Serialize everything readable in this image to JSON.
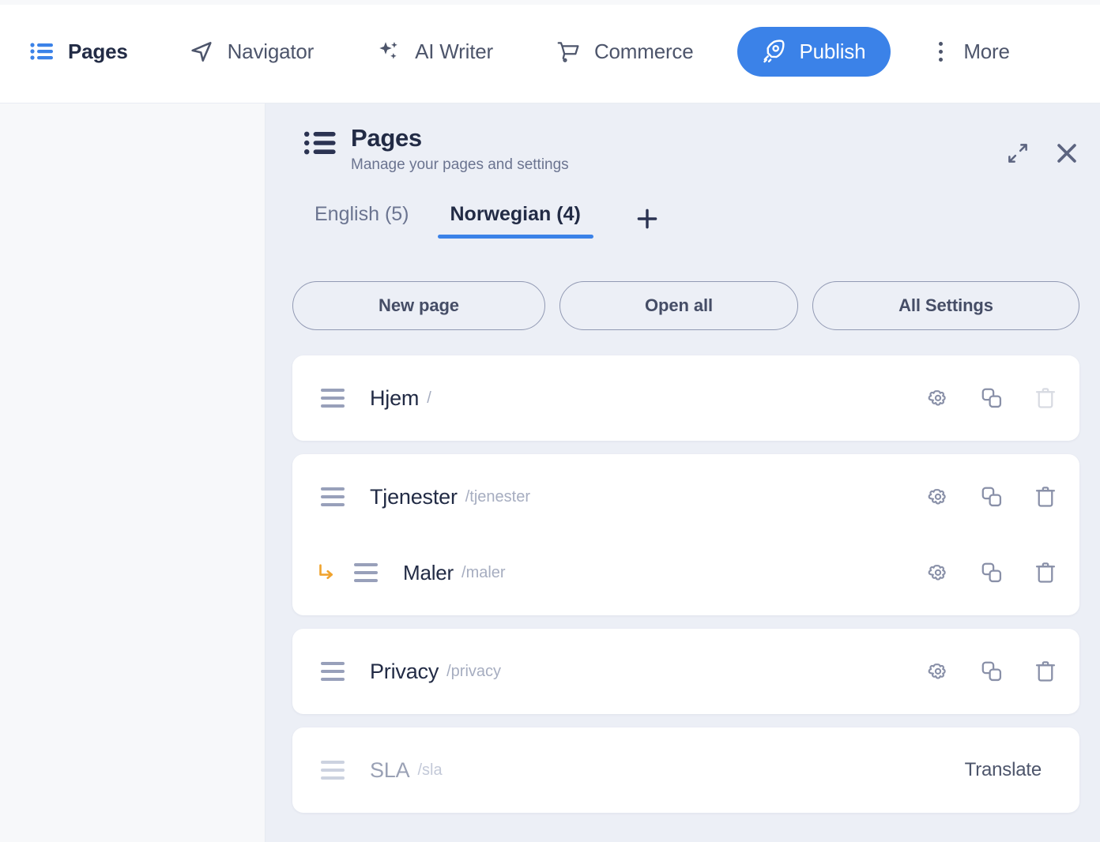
{
  "topbar": {
    "items": [
      {
        "id": "pages",
        "label": "Pages",
        "icon": "list-icon",
        "active": true
      },
      {
        "id": "navigator",
        "label": "Navigator",
        "icon": "navigate-icon",
        "active": false
      },
      {
        "id": "aiwriter",
        "label": "AI Writer",
        "icon": "sparkles-icon",
        "active": false
      },
      {
        "id": "commerce",
        "label": "Commerce",
        "icon": "cart-icon",
        "active": false
      }
    ],
    "publish": {
      "label": "Publish",
      "icon": "rocket-icon",
      "color": "#3b82e8"
    },
    "more": {
      "label": "More",
      "icon": "kebab-menu-icon"
    }
  },
  "panel": {
    "icon": "list-icon",
    "title": "Pages",
    "subtitle": "Manage your pages and settings",
    "expand_icon": "expand-icon",
    "close_icon": "close-icon",
    "tabs": [
      {
        "label": "English (5)",
        "active": false
      },
      {
        "label": "Norwegian (4)",
        "active": true
      }
    ],
    "add_tab_icon": "plus-icon",
    "buttons": {
      "new_page": "New page",
      "open_all": "Open all",
      "all_settings": "All Settings"
    },
    "accent_color": "#3b82e8",
    "child_arrow_color": "#f0a32e",
    "cards": [
      {
        "rows": [
          {
            "title": "Hjem",
            "slug": "/",
            "child": false,
            "dim": false,
            "actions": [
              {
                "name": "settings-icon",
                "label": "Settings",
                "disabled": false
              },
              {
                "name": "duplicate-icon",
                "label": "Duplicate",
                "disabled": false
              },
              {
                "name": "delete-icon",
                "label": "Delete",
                "disabled": true
              }
            ]
          }
        ]
      },
      {
        "rows": [
          {
            "title": "Tjenester",
            "slug": "/tjenester",
            "child": false,
            "dim": false,
            "actions": [
              {
                "name": "settings-icon",
                "label": "Settings",
                "disabled": false
              },
              {
                "name": "duplicate-icon",
                "label": "Duplicate",
                "disabled": false
              },
              {
                "name": "delete-icon",
                "label": "Delete",
                "disabled": false
              }
            ]
          },
          {
            "title": "Maler",
            "slug": "/maler",
            "child": true,
            "dim": false,
            "actions": [
              {
                "name": "settings-icon",
                "label": "Settings",
                "disabled": false
              },
              {
                "name": "duplicate-icon",
                "label": "Duplicate",
                "disabled": false
              },
              {
                "name": "delete-icon",
                "label": "Delete",
                "disabled": false
              }
            ]
          }
        ]
      },
      {
        "rows": [
          {
            "title": "Privacy",
            "slug": "/privacy",
            "child": false,
            "dim": false,
            "actions": [
              {
                "name": "settings-icon",
                "label": "Settings",
                "disabled": false
              },
              {
                "name": "duplicate-icon",
                "label": "Duplicate",
                "disabled": false
              },
              {
                "name": "delete-icon",
                "label": "Delete",
                "disabled": false
              }
            ]
          }
        ]
      },
      {
        "rows": [
          {
            "title": "SLA",
            "slug": "/sla",
            "child": false,
            "dim": true,
            "translate_label": "Translate",
            "actions": []
          }
        ]
      }
    ]
  }
}
